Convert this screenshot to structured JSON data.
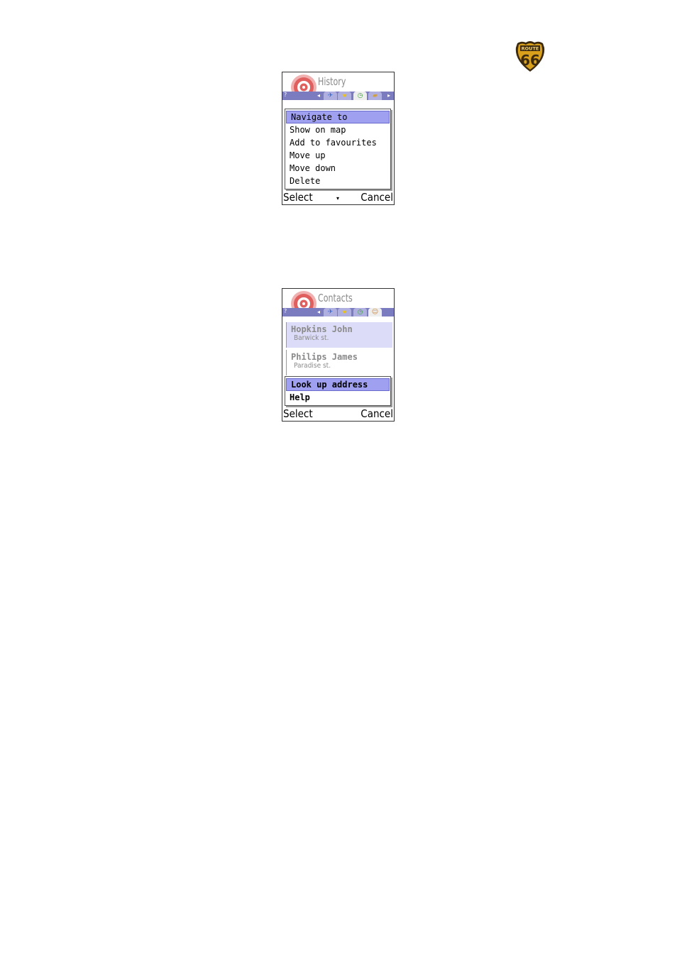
{
  "logo": {
    "icon": "route-66-shield-icon",
    "text": "66",
    "colors": {
      "gold": "#d9a01c",
      "dark": "#3b2a10"
    }
  },
  "history_screen": {
    "title": "History",
    "tab_help": "?",
    "tabs": [
      {
        "icon": "satellite-icon",
        "glyph": "✈",
        "active": false
      },
      {
        "icon": "star-icon",
        "glyph": "★",
        "active": false
      },
      {
        "icon": "clock-icon",
        "glyph": "◷",
        "active": true
      },
      {
        "icon": "folder-icon",
        "glyph": "▰",
        "active": false
      }
    ],
    "menu": [
      {
        "label": "Navigate to",
        "highlighted": true
      },
      {
        "label": "Show on map",
        "highlighted": false
      },
      {
        "label": "Add to favourites",
        "highlighted": false
      },
      {
        "label": "Move up",
        "highlighted": false
      },
      {
        "label": "Move down",
        "highlighted": false
      },
      {
        "label": "Delete",
        "highlighted": false
      }
    ],
    "softkeys": {
      "left": "Select",
      "right": "Cancel",
      "middle_icon": "scroll-down-icon",
      "middle_glyph": "▾"
    }
  },
  "contacts_screen": {
    "title": "Contacts",
    "tab_help": "?",
    "tabs": [
      {
        "icon": "satellite-icon",
        "glyph": "✈",
        "active": false
      },
      {
        "icon": "star-icon",
        "glyph": "★",
        "active": false
      },
      {
        "icon": "clock-icon",
        "glyph": "◷",
        "active": false
      },
      {
        "icon": "person-icon",
        "glyph": "☺",
        "active": true
      }
    ],
    "contacts": [
      {
        "name": "Hopkins John",
        "address": "Barwick st.",
        "selected": true
      },
      {
        "name": "Philips James",
        "address": "Paradise st.",
        "selected": false
      }
    ],
    "menu": [
      {
        "label": "Look up address",
        "highlighted": true
      },
      {
        "label": "Help",
        "highlighted": false
      }
    ],
    "softkeys": {
      "left": "Select",
      "right": "Cancel"
    }
  },
  "colors": {
    "highlight": "#a0a0f0",
    "tab_strip": "#7b7bc0",
    "title_gray": "#8a8a8a",
    "target_red": "#e06060"
  }
}
